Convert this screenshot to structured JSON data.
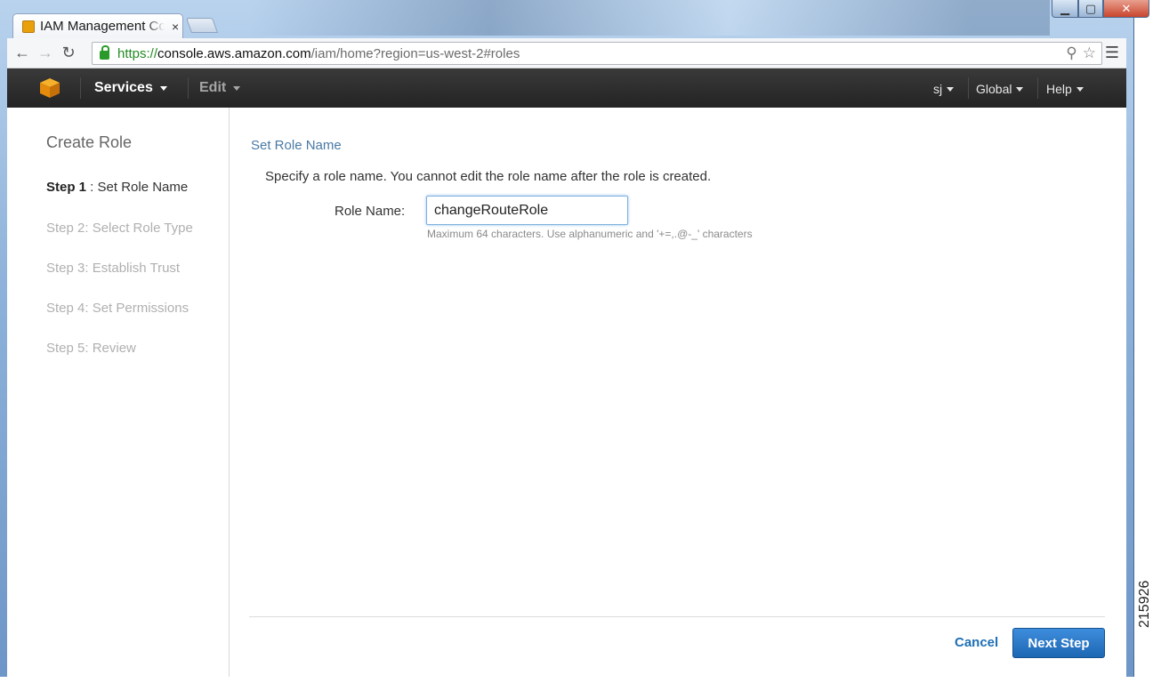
{
  "browser": {
    "tab_title": "IAM Management Co",
    "tab_close": "×",
    "url_https": "https://",
    "url_host": "console.aws.amazon.com",
    "url_path": "/iam/home?region=us-west-2#roles",
    "icons": [
      "back-arrow-icon",
      "forward-arrow-icon",
      "reload-icon",
      "lock-icon",
      "zoom-icon",
      "star-icon",
      "menu-icon"
    ]
  },
  "aws_nav": {
    "services": "Services",
    "edit": "Edit",
    "user": "sj",
    "region": "Global",
    "help": "Help"
  },
  "sidebar": {
    "title": "Create Role",
    "active_step_prefix": "Step 1",
    "active_step_label": " : Set Role Name",
    "steps": [
      "Step 2: Select Role Type",
      "Step 3: Establish Trust",
      "Step 4: Set Permissions",
      "Step 5: Review"
    ]
  },
  "main": {
    "section_title": "Set Role Name",
    "description": "Specify a role name. You cannot edit the role name after the role is created.",
    "role_name_label": "Role Name:",
    "role_name_value": "changeRouteRole",
    "hint": "Maximum 64 characters. Use alphanumeric and '+=,.@-_' characters"
  },
  "footer": {
    "cancel": "Cancel",
    "next": "Next Step"
  },
  "figure_id": "215926",
  "colors": {
    "accent": "#1d67b3",
    "section_title": "#4a7aa5",
    "nav_bg": "#232323"
  }
}
